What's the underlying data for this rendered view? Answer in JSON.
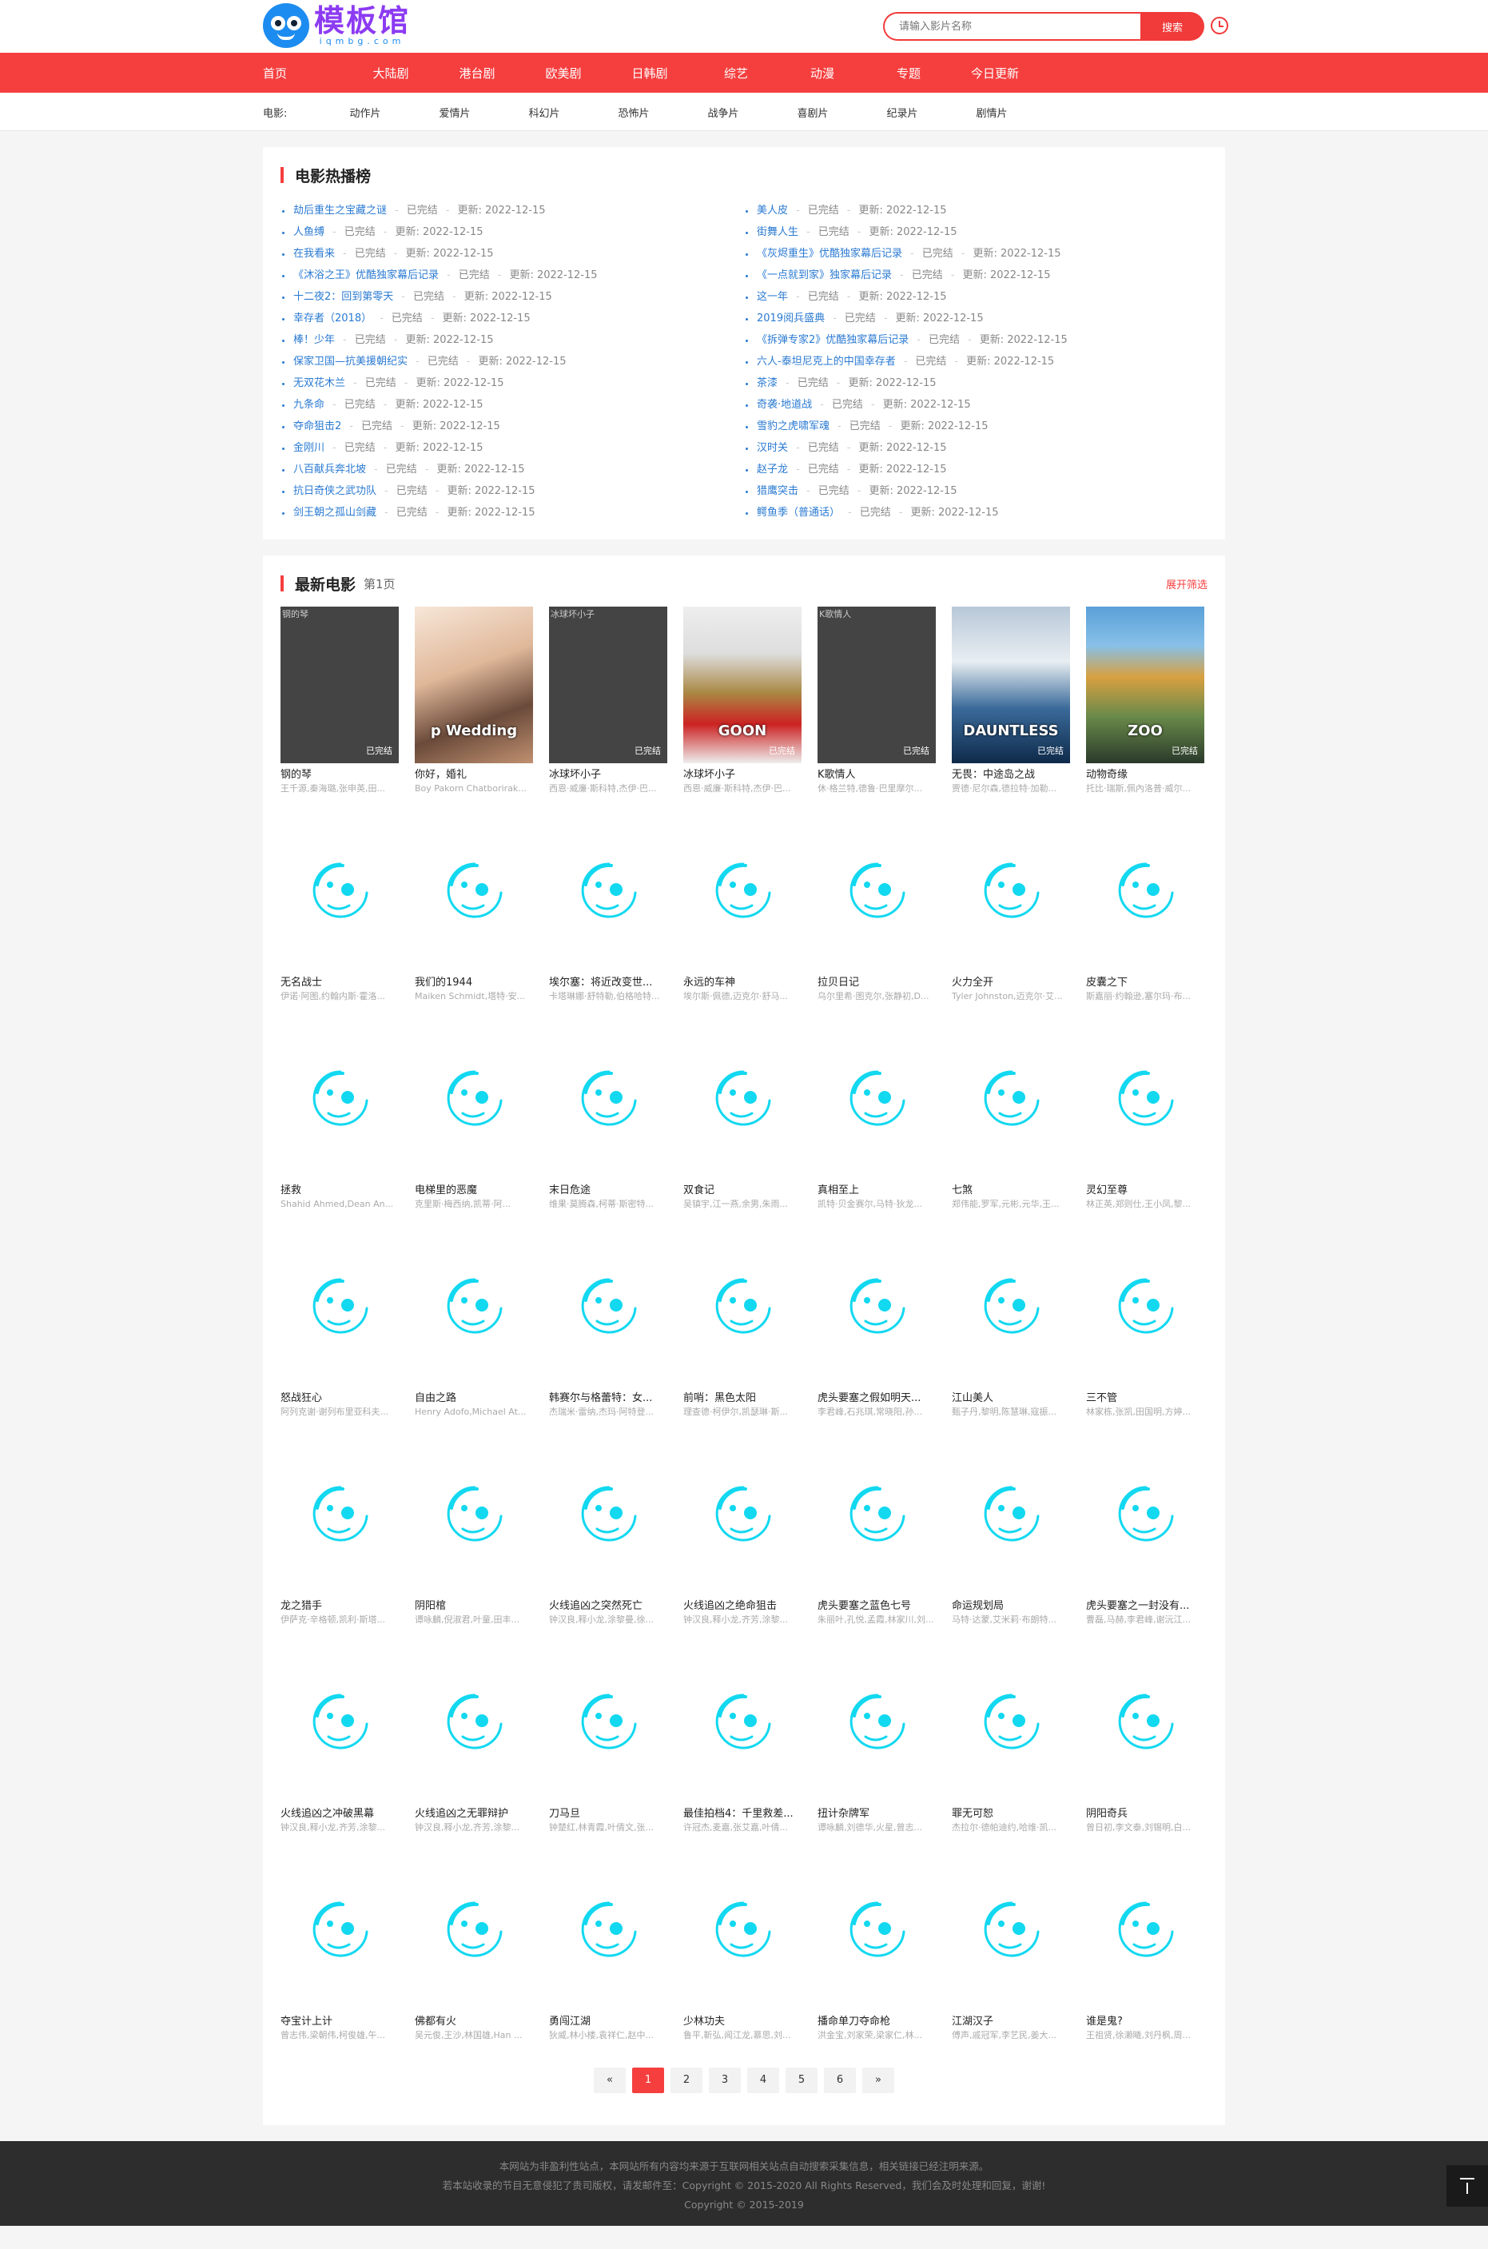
{
  "header": {
    "logo_title": "模板馆",
    "logo_sub": "iqmbg.com",
    "search_placeholder": "请输入影片名称",
    "search_button": "搜索"
  },
  "nav": [
    "首页",
    "大陆剧",
    "港台剧",
    "欧美剧",
    "日韩剧",
    "综艺",
    "动漫",
    "专题",
    "今日更新"
  ],
  "subnav": {
    "label": "电影:",
    "items": [
      "动作片",
      "爱情片",
      "科幻片",
      "恐怖片",
      "战争片",
      "喜剧片",
      "纪录片",
      "剧情片"
    ]
  },
  "hot": {
    "title": "电影热播榜",
    "status_label": "已完结",
    "update_label": "更新:",
    "col1": [
      {
        "t": "劫后重生之宝藏之谜",
        "d": "2022-12-15"
      },
      {
        "t": "人鱼缚",
        "d": "2022-12-15"
      },
      {
        "t": "在我看来",
        "d": "2022-12-15"
      },
      {
        "t": "《沐浴之王》优酷独家幕后记录",
        "d": "2022-12-15"
      },
      {
        "t": "十二夜2：回到第零天",
        "d": "2022-12-15"
      },
      {
        "t": "幸存者（2018）",
        "d": "2022-12-15"
      },
      {
        "t": "棒！少年",
        "d": "2022-12-15"
      },
      {
        "t": "保家卫国—抗美援朝纪实",
        "d": "2022-12-15"
      },
      {
        "t": "无双花木兰",
        "d": "2022-12-15"
      },
      {
        "t": "九条命",
        "d": "2022-12-15"
      },
      {
        "t": "夺命狙击2",
        "d": "2022-12-15"
      },
      {
        "t": "金刚川",
        "d": "2022-12-15"
      },
      {
        "t": "八百献兵奔北坡",
        "d": "2022-12-15"
      },
      {
        "t": "抗日奇侠之武功队",
        "d": "2022-12-15"
      },
      {
        "t": "剑王朝之孤山剑藏",
        "d": "2022-12-15"
      }
    ],
    "col2": [
      {
        "t": "美人皮",
        "d": "2022-12-15"
      },
      {
        "t": "街舞人生",
        "d": "2022-12-15"
      },
      {
        "t": "《灰烬重生》优酷独家幕后记录",
        "d": "2022-12-15"
      },
      {
        "t": "《一点就到家》独家幕后记录",
        "d": "2022-12-15"
      },
      {
        "t": "这一年",
        "d": "2022-12-15"
      },
      {
        "t": "2019阅兵盛典",
        "d": "2022-12-15"
      },
      {
        "t": "《拆弹专家2》优酷独家幕后记录",
        "d": "2022-12-15"
      },
      {
        "t": "六人-泰坦尼克上的中国幸存者",
        "d": "2022-12-15"
      },
      {
        "t": "茶漆",
        "d": "2022-12-15"
      },
      {
        "t": "奇袭·地道战",
        "d": "2022-12-15"
      },
      {
        "t": "雪豹之虎啸军魂",
        "d": "2022-12-15"
      },
      {
        "t": "汉时关",
        "d": "2022-12-15"
      },
      {
        "t": "赵子龙",
        "d": "2022-12-15"
      },
      {
        "t": "猎鹰突击",
        "d": "2022-12-15"
      },
      {
        "t": "鳄鱼季（普通话）",
        "d": "2022-12-15"
      }
    ]
  },
  "latest": {
    "title": "最新电影",
    "page": "第1页",
    "filter": "展开筛选",
    "movies": [
      {
        "name": "钢的琴",
        "cast": "王千源,秦海璐,张申英,田...",
        "poster": "dark",
        "alt": "钢的琴",
        "badge": "已完结"
      },
      {
        "name": "你好，婚礼",
        "cast": "Boy Pakorn Chatborirak...",
        "poster": "art1",
        "art_title": "p Wedding",
        "badge": ""
      },
      {
        "name": "冰球坏小子",
        "cast": "西恩·威廉·斯科特,杰伊·巴...",
        "poster": "dark",
        "alt": "冰球坏小子",
        "badge": "已完结"
      },
      {
        "name": "冰球坏小子",
        "cast": "西恩·威廉·斯科特,杰伊·巴...",
        "poster": "art2",
        "art_title": "GOON",
        "badge": "已完结"
      },
      {
        "name": "K歌情人",
        "cast": "休·格兰特,德鲁·巴里摩尔...",
        "poster": "dark",
        "alt": "K歌情人",
        "badge": "已完结"
      },
      {
        "name": "无畏：中途岛之战",
        "cast": "贾德·尼尔森,德拉特·加勒...",
        "poster": "art3",
        "art_title": "DAUNTLESS",
        "badge": "已完结"
      },
      {
        "name": "动物奇缘",
        "cast": "托比·瑞斯,佩內洛普·威尔...",
        "poster": "art4",
        "art_title": "ZOO",
        "badge": "已完结"
      },
      {
        "name": "无名战士",
        "cast": "伊诺·阿图,约翰内斯·霍洛...",
        "poster": "ph"
      },
      {
        "name": "我们的1944",
        "cast": "Maiken Schmidt,塔特·安...",
        "poster": "ph"
      },
      {
        "name": "埃尔塞：将近改变世...",
        "cast": "卡塔琳娜·舒特勒,伯格哈特...",
        "poster": "ph"
      },
      {
        "name": "永远的车神",
        "cast": "埃尔斯·佩德,迈克尔·舒马...",
        "poster": "ph"
      },
      {
        "name": "拉贝日记",
        "cast": "乌尔里希·图克尔,张静初,D...",
        "poster": "ph"
      },
      {
        "name": "火力全开",
        "cast": "Tyler Johnston,迈克尔·艾...",
        "poster": "ph"
      },
      {
        "name": "皮囊之下",
        "cast": "斯嘉丽·约翰逊,塞尔玛·布...",
        "poster": "ph"
      },
      {
        "name": "拯救",
        "cast": "Shahid Ahmed,Dean An...",
        "poster": "ph"
      },
      {
        "name": "电梯里的恶魔",
        "cast": "克里斯·梅西纳,凯蒂·阿...",
        "poster": "ph"
      },
      {
        "name": "末日危途",
        "cast": "维果·莫腾森,柯蒂·斯密特...",
        "poster": "ph"
      },
      {
        "name": "双食记",
        "cast": "吴镇宇,江一燕,余男,朱雨...",
        "poster": "ph"
      },
      {
        "name": "真相至上",
        "cast": "凯特·贝金赛尔,马特·狄龙...",
        "poster": "ph"
      },
      {
        "name": "七煞",
        "cast": "郑伟能,罗军,元彬,元华,王...",
        "poster": "ph"
      },
      {
        "name": "灵幻至尊",
        "cast": "林正英,郑则仕,王小凤,黎...",
        "poster": "ph"
      },
      {
        "name": "怒战狂心",
        "cast": "阿列克谢·谢列布里亚科夫...",
        "poster": "ph"
      },
      {
        "name": "自由之路",
        "cast": "Henry Adofo,Michael At...",
        "poster": "ph"
      },
      {
        "name": "韩赛尔与格蕾特：女...",
        "cast": "杰瑞米·雷纳,杰玛·阿特登...",
        "poster": "ph"
      },
      {
        "name": "前哨：黑色太阳",
        "cast": "理查德·柯伊尔,凯瑟琳·斯...",
        "poster": "ph"
      },
      {
        "name": "虎头要塞之假如明天...",
        "cast": "李君峰,石兆琪,常晓阳,孙...",
        "poster": "ph"
      },
      {
        "name": "江山美人",
        "cast": "甄子丹,黎明,陈慧琳,寇振...",
        "poster": "ph"
      },
      {
        "name": "三不管",
        "cast": "林家栋,张凯,田国明,方婷...",
        "poster": "ph"
      },
      {
        "name": "龙之猎手",
        "cast": "伊萨克·辛格顿,凯利·斯塔...",
        "poster": "ph"
      },
      {
        "name": "阴阳棺",
        "cast": "谭咏麟,倪淑君,叶童,田丰...",
        "poster": "ph"
      },
      {
        "name": "火线追凶之突然死亡",
        "cast": "钟汉良,释小龙,涂黎曼,徐...",
        "poster": "ph"
      },
      {
        "name": "火线追凶之绝命狙击",
        "cast": "钟汉良,释小龙,齐芳,涂黎...",
        "poster": "ph"
      },
      {
        "name": "虎头要塞之蓝色七号",
        "cast": "朱丽叶,孔悦,孟霞,林家川,刘...",
        "poster": "ph"
      },
      {
        "name": "命运规划局",
        "cast": "马特·达蒙,艾米莉·布朗特...",
        "poster": "ph"
      },
      {
        "name": "虎头要塞之一封没有...",
        "cast": "曹磊,马赫,李君峰,谢沅江...",
        "poster": "ph"
      },
      {
        "name": "火线追凶之冲破黑幕",
        "cast": "钟汉良,释小龙,齐芳,涂黎...",
        "poster": "ph"
      },
      {
        "name": "火线追凶之无罪辩护",
        "cast": "钟汉良,释小龙,齐芳,涂黎...",
        "poster": "ph"
      },
      {
        "name": "刀马旦",
        "cast": "钟楚红,林青霞,叶倩文,张...",
        "poster": "ph"
      },
      {
        "name": "最佳拍档4：千里救差...",
        "cast": "许冠杰,麦嘉,张艾嘉,叶倩...",
        "poster": "ph"
      },
      {
        "name": "扭计杂牌军",
        "cast": "谭咏麟,刘德华,火星,曾志...",
        "poster": "ph"
      },
      {
        "name": "罪无可恕",
        "cast": "杰拉尔·德帕迪约,哈维·凯...",
        "poster": "ph"
      },
      {
        "name": "阴阳奇兵",
        "cast": "曾日初,李文泰,刘锡明,白...",
        "poster": "ph"
      },
      {
        "name": "夺宝计上计",
        "cast": "曾志伟,梁朝伟,柯俊雄,午...",
        "poster": "ph"
      },
      {
        "name": "佛都有火",
        "cast": "吴元俊,王沙,林国雄,Han ...",
        "poster": "ph"
      },
      {
        "name": "勇闯江湖",
        "cast": "狄威,林小楼,袁祥仁,赵中...",
        "poster": "ph"
      },
      {
        "name": "少林功夫",
        "cast": "鲁平,靳弘,闻江龙,慕思,刘...",
        "poster": "ph"
      },
      {
        "name": "播命单刀夺命枪",
        "cast": "洪金宝,刘家荣,梁家仁,林...",
        "poster": "ph"
      },
      {
        "name": "江湖汉子",
        "cast": "傅声,戚冠军,李艺民,姜大...",
        "poster": "ph"
      },
      {
        "name": "谁是鬼?",
        "cast": "王祖贤,徐濑曦,刘丹枫,周...",
        "poster": "ph"
      }
    ]
  },
  "pager": [
    "«",
    "1",
    "2",
    "3",
    "4",
    "5",
    "6",
    "»"
  ],
  "footer": {
    "line1": "本网站为非盈利性站点，本网站所有内容均来源于互联网相关站点自动搜索采集信息，相关链接已经注明来源。",
    "line2": "若本站收录的节目无意侵犯了贵司版权，请发邮件至：Copyright © 2015-2020 All Rights Reserved，我们会及时处理和回复，谢谢!",
    "line3": "Copyright © 2015-2019"
  },
  "colors": {
    "accent": "#f53f3f",
    "link": "#2a7ad2",
    "logo": "#8c3bf2",
    "placeholder_icon": "#12d8f0"
  }
}
